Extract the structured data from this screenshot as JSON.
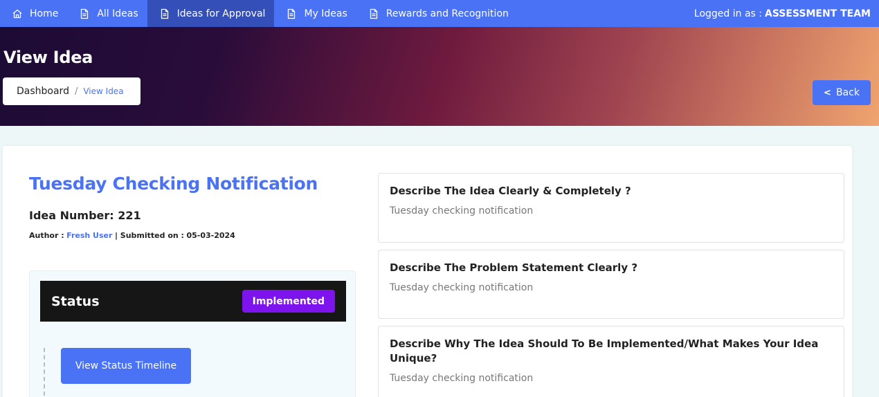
{
  "nav": {
    "items": [
      {
        "label": "Home",
        "icon": "home-icon"
      },
      {
        "label": "All Ideas",
        "icon": "document-icon"
      },
      {
        "label": "Ideas for Approval",
        "icon": "document-icon"
      },
      {
        "label": "My Ideas",
        "icon": "document-icon"
      },
      {
        "label": "Rewards and Recognition",
        "icon": "document-icon"
      }
    ],
    "active_index": 2,
    "logged_in_prefix": "Logged in as :",
    "logged_in_user": "ASSESSMENT TEAM"
  },
  "header": {
    "title": "View Idea",
    "breadcrumb": {
      "home": "Dashboard",
      "separator": "/",
      "current": "View Idea"
    },
    "back_label": "Back"
  },
  "idea": {
    "title": "Tuesday Checking Notification",
    "number": "Idea Number: 221",
    "author_label": "Author :",
    "author_name": "Fresh User",
    "submitted_label": "| Submitted on :",
    "submitted_date": "05-03-2024"
  },
  "status": {
    "title": "Status",
    "badge": "Implemented",
    "timeline_button": "View Status Timeline"
  },
  "questions": [
    {
      "question": "Describe The Idea Clearly & Completely ?",
      "answer": "Tuesday checking notification"
    },
    {
      "question": "Describe The Problem Statement Clearly ?",
      "answer": "Tuesday checking notification"
    },
    {
      "question": "Describe Why The Idea Should To Be Implemented/What Makes Your Idea Unique?",
      "answer": "Tuesday checking notification"
    }
  ],
  "colors": {
    "nav_bg": "#4a72f5",
    "nav_active": "#3450b8",
    "accent": "#4a72f5",
    "badge": "#7d14ee",
    "status_header": "#161616"
  }
}
